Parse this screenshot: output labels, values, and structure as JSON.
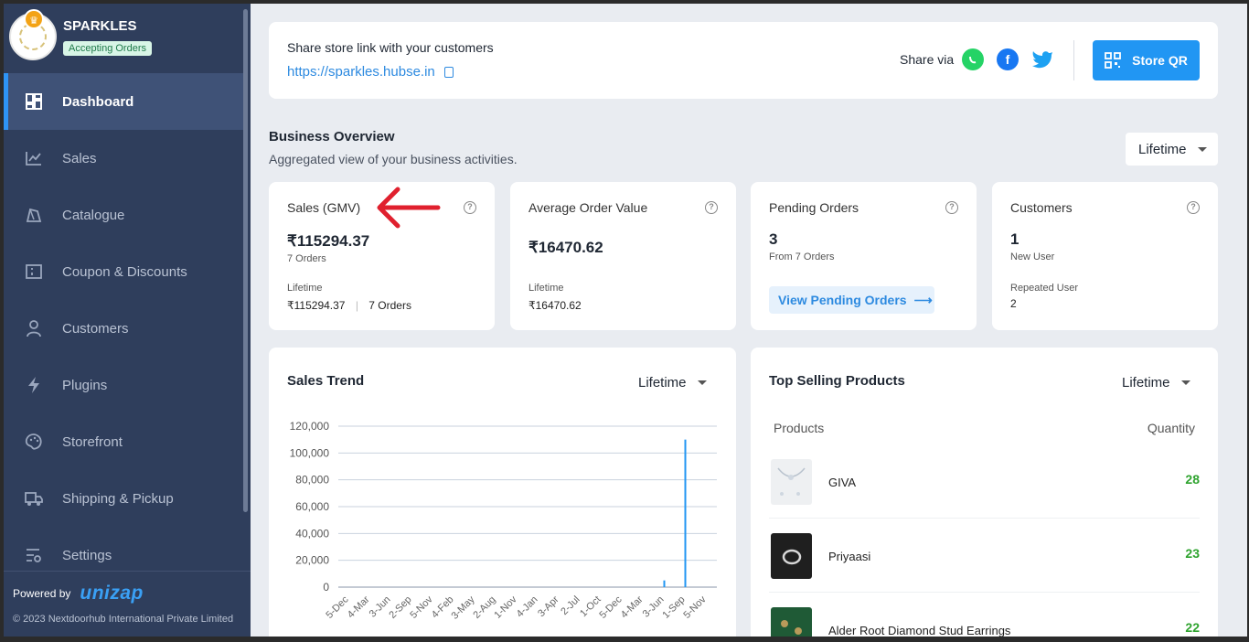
{
  "store": {
    "name": "SPARKLES",
    "status": "Accepting Orders"
  },
  "nav": {
    "items": [
      {
        "label": "Dashboard",
        "icon": "dashboard-icon",
        "active": true
      },
      {
        "label": "Sales",
        "icon": "chart-line-icon"
      },
      {
        "label": "Catalogue",
        "icon": "tag-icon"
      },
      {
        "label": "Coupon & Discounts",
        "icon": "coupon-icon"
      },
      {
        "label": "Customers",
        "icon": "user-icon"
      },
      {
        "label": "Plugins",
        "icon": "bolt-icon"
      },
      {
        "label": "Storefront",
        "icon": "palette-icon"
      },
      {
        "label": "Shipping & Pickup",
        "icon": "truck-icon"
      },
      {
        "label": "Settings",
        "icon": "settings-icon"
      }
    ]
  },
  "footer": {
    "powered": "Powered by",
    "brand": "unizap",
    "copyright": "© 2023 Nextdoorhub International Private Limited"
  },
  "share": {
    "title": "Share store link with your customers",
    "link": "https://sparkles.hubse.in",
    "share_via": "Share via",
    "qr_label": "Store QR"
  },
  "overview": {
    "title": "Business Overview",
    "subtitle": "Aggregated view of your business activities.",
    "period": "Lifetime"
  },
  "stats": {
    "sales": {
      "title": "Sales (GMV)",
      "value": "₹115294.37",
      "orders": "7 Orders",
      "period": "Lifetime",
      "period_value": "₹115294.37",
      "period_orders": "7 Orders"
    },
    "aov": {
      "title": "Average Order Value",
      "value": "₹16470.62",
      "period": "Lifetime",
      "period_value": "₹16470.62"
    },
    "pending": {
      "title": "Pending Orders",
      "value": "3",
      "sub": "From 7 Orders",
      "button": "View Pending Orders"
    },
    "customers": {
      "title": "Customers",
      "value": "1",
      "sub": "New User",
      "repeated_label": "Repeated User",
      "repeated_value": "2"
    }
  },
  "sales_trend": {
    "title": "Sales Trend",
    "period": "Lifetime"
  },
  "chart_data": {
    "type": "bar",
    "title": "Sales Trend",
    "ylim": [
      0,
      120000
    ],
    "yticks": [
      "120,000",
      "100,000",
      "80,000",
      "60,000",
      "40,000",
      "20,000",
      "0"
    ],
    "categories": [
      "5-Dec",
      "4-Mar",
      "3-Jun",
      "2-Sep",
      "5-Nov",
      "4-Feb",
      "3-May",
      "2-Aug",
      "1-Nov",
      "4-Jan",
      "3-Apr",
      "2-Jul",
      "1-Oct",
      "5-Dec",
      "4-Mar",
      "3-Jun",
      "1-Sep",
      "5-Nov"
    ],
    "series": [
      {
        "values": [
          0,
          0,
          0,
          0,
          0,
          0,
          0,
          0,
          0,
          0,
          0,
          0,
          0,
          0,
          0,
          5000,
          110000,
          0
        ]
      }
    ],
    "grid": true,
    "color": "#2196f3"
  },
  "top_selling": {
    "title": "Top Selling Products",
    "period": "Lifetime",
    "col_products": "Products",
    "col_quantity": "Quantity",
    "rows": [
      {
        "name": "GIVA",
        "qty": "28"
      },
      {
        "name": "Priyaasi",
        "qty": "23"
      },
      {
        "name": "Alder Root Diamond Stud Earrings",
        "qty": "22"
      }
    ]
  }
}
